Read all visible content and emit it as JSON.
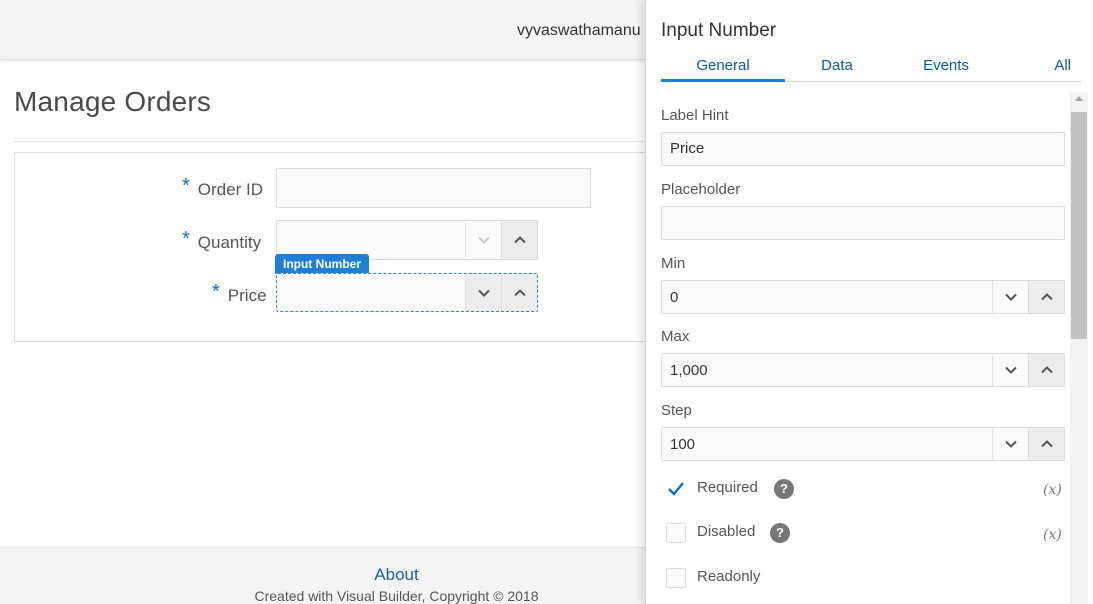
{
  "app": {
    "user_name": "vyvaswathamanu",
    "page_title": "Manage Orders",
    "footer_link": "About",
    "footer_copyright": "Created with Visual Builder, Copyright © 2018"
  },
  "form": {
    "required_marker": "*",
    "fields": [
      {
        "label": "Order ID",
        "type": "text",
        "value": ""
      },
      {
        "label": "Quantity",
        "type": "number",
        "value": ""
      },
      {
        "label": "Price",
        "type": "number",
        "value": "",
        "selected": true
      }
    ],
    "selection_tag": "Input Number"
  },
  "inspector": {
    "title": "Input Number",
    "tabs": [
      {
        "label": "General",
        "active": true
      },
      {
        "label": "Data",
        "active": false
      },
      {
        "label": "Events",
        "active": false
      },
      {
        "label": "All",
        "active": false
      }
    ],
    "properties": {
      "label_hint": {
        "label": "Label Hint",
        "value": "Price"
      },
      "placeholder": {
        "label": "Placeholder",
        "value": ""
      },
      "min": {
        "label": "Min",
        "value": "0"
      },
      "max": {
        "label": "Max",
        "value": "1,000"
      },
      "step": {
        "label": "Step",
        "value": "100"
      }
    },
    "checkboxes": [
      {
        "label": "Required",
        "checked": true,
        "help": "?",
        "expression": "(x)"
      },
      {
        "label": "Disabled",
        "checked": false,
        "help": "?",
        "expression": "(x)"
      },
      {
        "label": "Readonly",
        "checked": false
      }
    ]
  },
  "colors": {
    "accent": "#1f7fd4",
    "link": "#0b5aa6",
    "required_marker": "#0572ce",
    "header_bg": "#f4f4f4"
  },
  "icons": {
    "spin_down": "chevron-down-icon",
    "spin_up": "chevron-up-icon",
    "check": "checkmark-icon",
    "help": "help-icon",
    "expression": "variable-expression-icon"
  }
}
